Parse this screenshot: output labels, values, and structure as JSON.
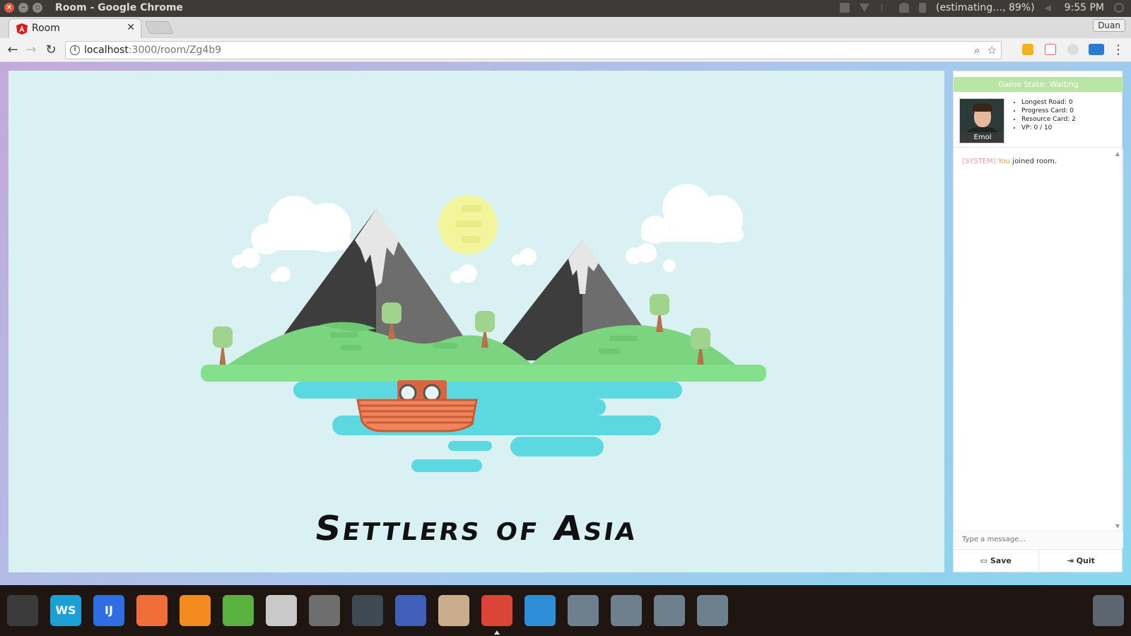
{
  "os": {
    "window_title": "Room - Google Chrome",
    "battery_text": "(estimating…, 89%)",
    "clock": "9:55 PM"
  },
  "browser": {
    "tab_title": "Room",
    "profile_name": "Duan",
    "url_host": "localhost",
    "url_path": ":3000/room/Zg4b9"
  },
  "game": {
    "logo_text": "Settlers of Asia",
    "state_label": "Game State: Waiting",
    "player": {
      "name": "Emol",
      "stats": [
        "Longest Road: 0",
        "Progress Card: 0",
        "Resource Card: 2",
        "VP: 0 / 10"
      ]
    },
    "chat": {
      "system_tag": "[SYSTEM]",
      "actor": "You",
      "message": " joined room.",
      "input_placeholder": "Type a message..."
    },
    "buttons": {
      "save": "Save",
      "quit": "Quit"
    }
  },
  "dock": [
    {
      "name": "ubuntu-dash-icon",
      "color": "#3b3b3b"
    },
    {
      "name": "webstorm-icon",
      "color": "#1aa0d7",
      "label": "WS"
    },
    {
      "name": "intellij-icon",
      "color": "#2f6ee2",
      "label": "IJ"
    },
    {
      "name": "impress-icon",
      "color": "#f16d3a"
    },
    {
      "name": "firefox-icon",
      "color": "#f58a1f"
    },
    {
      "name": "calc-icon",
      "color": "#59b13e"
    },
    {
      "name": "files-icon",
      "color": "#c9c9c9"
    },
    {
      "name": "settings-icon",
      "color": "#6e6e6e"
    },
    {
      "name": "terminal-icon",
      "color": "#3e4a52"
    },
    {
      "name": "writer-icon",
      "color": "#3f5fb8"
    },
    {
      "name": "archive-icon",
      "color": "#c9ad8c"
    },
    {
      "name": "chrome-icon",
      "color": "#db4437"
    },
    {
      "name": "remmina-icon",
      "color": "#2e8fd8"
    },
    {
      "name": "drive-icon",
      "color": "#6e7f8e"
    },
    {
      "name": "drive-icon",
      "color": "#6e7f8e"
    },
    {
      "name": "drive-icon",
      "color": "#6e7f8e"
    },
    {
      "name": "drive-icon",
      "color": "#6e7f8e"
    }
  ],
  "colors": {
    "board_bg": "#d9f1f3",
    "game_state_bg": "#b9e6a4",
    "grass": "#85e08c",
    "water": "#5cd9e0",
    "sun": "#f2f59c",
    "mountain_dark": "#3d3d3d",
    "mountain_light": "#6d6d6d"
  }
}
